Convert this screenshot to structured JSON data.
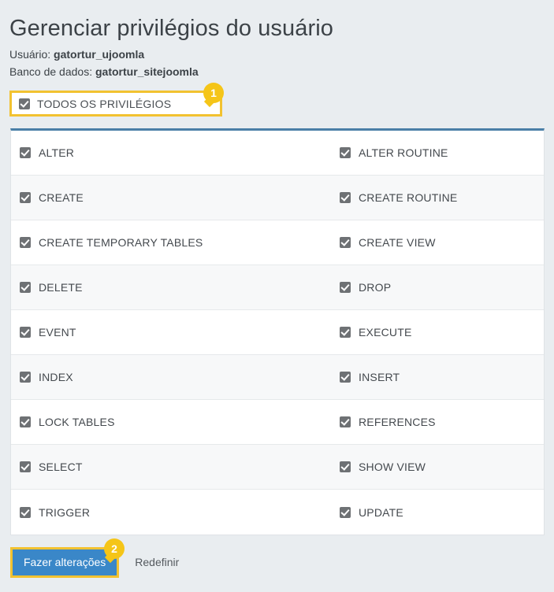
{
  "header": {
    "title": "Gerenciar privilégios do usuário",
    "user_label": "Usuário:",
    "user_value": "gatortur_ujoomla",
    "database_label": "Banco de dados:",
    "database_value": "gatortur_sitejoomla"
  },
  "all_privileges": {
    "label": "TODOS OS PRIVILÉGIOS",
    "checked": true,
    "badge": "1",
    "highlight_color": "#f2c230"
  },
  "privileges_table": {
    "accent_color": "#4a7fa7",
    "rows": [
      {
        "left": "ALTER",
        "right": "ALTER ROUTINE"
      },
      {
        "left": "CREATE",
        "right": "CREATE ROUTINE"
      },
      {
        "left": "CREATE TEMPORARY TABLES",
        "right": "CREATE VIEW"
      },
      {
        "left": "DELETE",
        "right": "DROP"
      },
      {
        "left": "EVENT",
        "right": "EXECUTE"
      },
      {
        "left": "INDEX",
        "right": "INSERT"
      },
      {
        "left": "LOCK TABLES",
        "right": "REFERENCES"
      },
      {
        "left": "SELECT",
        "right": "SHOW VIEW"
      },
      {
        "left": "TRIGGER",
        "right": "UPDATE"
      }
    ]
  },
  "actions": {
    "submit_label": "Fazer alterações",
    "submit_color": "#3a87c8",
    "reset_label": "Redefinir",
    "badge": "2",
    "highlight_color": "#f2c230"
  }
}
